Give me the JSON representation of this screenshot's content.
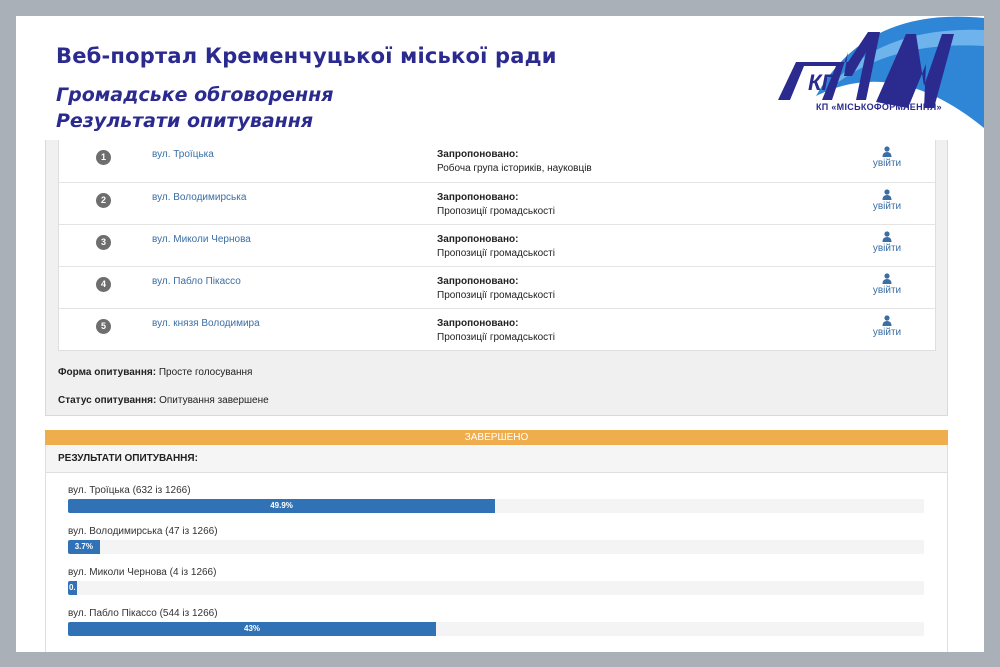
{
  "header": {
    "portal_title": "Веб-портал Кременчуцької міської ради",
    "subtitle_1": "Громадське обговорення",
    "subtitle_2": "Результати опитування",
    "logo_text": "КП",
    "logo_caption": "КП «МІСЬКОФОРМЛЕННЯ»"
  },
  "proposals": [
    {
      "num": "1",
      "street": "вул. Троїцька",
      "offered_label": "Запропоновано:",
      "offered_by": "Робоча група істориків, науковців",
      "login": "увійти"
    },
    {
      "num": "2",
      "street": "вул. Володимирська",
      "offered_label": "Запропоновано:",
      "offered_by": "Пропозиції громадськості",
      "login": "увійти"
    },
    {
      "num": "3",
      "street": "вул. Миколи Чернова",
      "offered_label": "Запропоновано:",
      "offered_by": "Пропозиції громадськості",
      "login": "увійти"
    },
    {
      "num": "4",
      "street": "вул. Пабло Пікассо",
      "offered_label": "Запропоновано:",
      "offered_by": "Пропозиції громадськості",
      "login": "увійти"
    },
    {
      "num": "5",
      "street": "вул. князя Володимира",
      "offered_label": "Запропоновано:",
      "offered_by": "Пропозиції громадськості",
      "login": "увійти"
    }
  ],
  "survey": {
    "form_label": "Форма опитування:",
    "form_value": "Просте голосування",
    "status_label": "Статус опитування:",
    "status_value": "Опитування завершене"
  },
  "results": {
    "status_banner": "ЗАВЕРШЕНО",
    "heading": "РЕЗУЛЬТАТИ ОПИТУВАННЯ:",
    "items": [
      {
        "label": "вул. Троїцька (632 із 1266)",
        "percent": 49.9,
        "percent_text": "49.9%"
      },
      {
        "label": "вул. Володимирська (47 із 1266)",
        "percent": 3.7,
        "percent_text": "3.7%"
      },
      {
        "label": "вул. Миколи Чернова (4 із 1266)",
        "percent": 0.3,
        "percent_text": "0."
      },
      {
        "label": "вул. Пабло Пікассо (544 із 1266)",
        "percent": 43,
        "percent_text": "43%"
      }
    ]
  },
  "colors": {
    "title": "#2b2a8e",
    "link": "#3a6ea5",
    "progress": "#3171b6",
    "banner": "#f0ad4e"
  },
  "icons": {
    "login": "user-icon",
    "logo": "kp-logo"
  }
}
